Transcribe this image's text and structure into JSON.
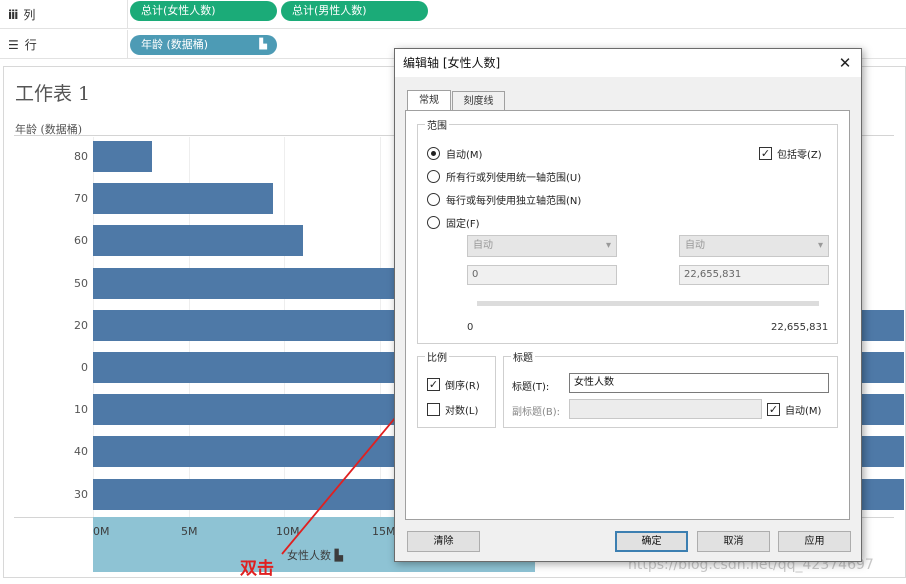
{
  "shelves": {
    "columns": {
      "label": "列",
      "pills": [
        "总计(女性人数)",
        "总计(男性人数)"
      ]
    },
    "rows": {
      "label": "行",
      "pill": "年龄 (数据桶)"
    }
  },
  "worksheet": {
    "title": "工作表 1",
    "row_header": "年龄 (数据桶)",
    "x_title": "女性人数",
    "x_ticks": [
      "0M",
      "5M",
      "10M",
      "15M"
    ]
  },
  "chart_data": {
    "type": "bar",
    "orientation": "horizontal",
    "categories": [
      "80",
      "70",
      "60",
      "50",
      "20",
      "0",
      "10",
      "40",
      "30"
    ],
    "values": [
      3.1,
      9.4,
      11.0,
      25,
      45,
      45,
      45,
      45,
      45
    ],
    "xlim": [
      0,
      22.655831
    ],
    "xlabel": "女性人数",
    "ylabel": "年龄 (数据桶)",
    "reversed": true
  },
  "dialog": {
    "title": "编辑轴 [女性人数]",
    "close": "✕",
    "tabs": [
      "常规",
      "刻度线"
    ],
    "range": {
      "title": "范围",
      "options": [
        "自动(M)",
        "所有行或列使用统一轴范围(U)",
        "每行或每列使用独立轴范围(N)",
        "固定(F)"
      ],
      "selected": 0,
      "include_zero": "包括零(Z)",
      "start_dropdown": "自动",
      "end_dropdown": "自动",
      "start_value": "0",
      "end_value": "22,655,831",
      "slider_min": "0",
      "slider_max": "22,655,831"
    },
    "scale": {
      "title": "比例",
      "reversed": "倒序(R)",
      "log": "对数(L)"
    },
    "titles": {
      "title": "标题",
      "title_label": "标题(T):",
      "title_value": "女性人数",
      "subtitle_label": "副标题(B):",
      "subtitle_value": "",
      "auto": "自动(M)"
    },
    "buttons": {
      "clear": "清除",
      "ok": "确定",
      "cancel": "取消",
      "apply": "应用"
    }
  },
  "annotation": "双击",
  "watermark": "https://blog.csdn.net/qq_42374697",
  "colors": {
    "bar": "#4e79a7",
    "pill_green": "#1bab78",
    "pill_blue": "#4d9bb5",
    "arrow": "#e02020"
  }
}
